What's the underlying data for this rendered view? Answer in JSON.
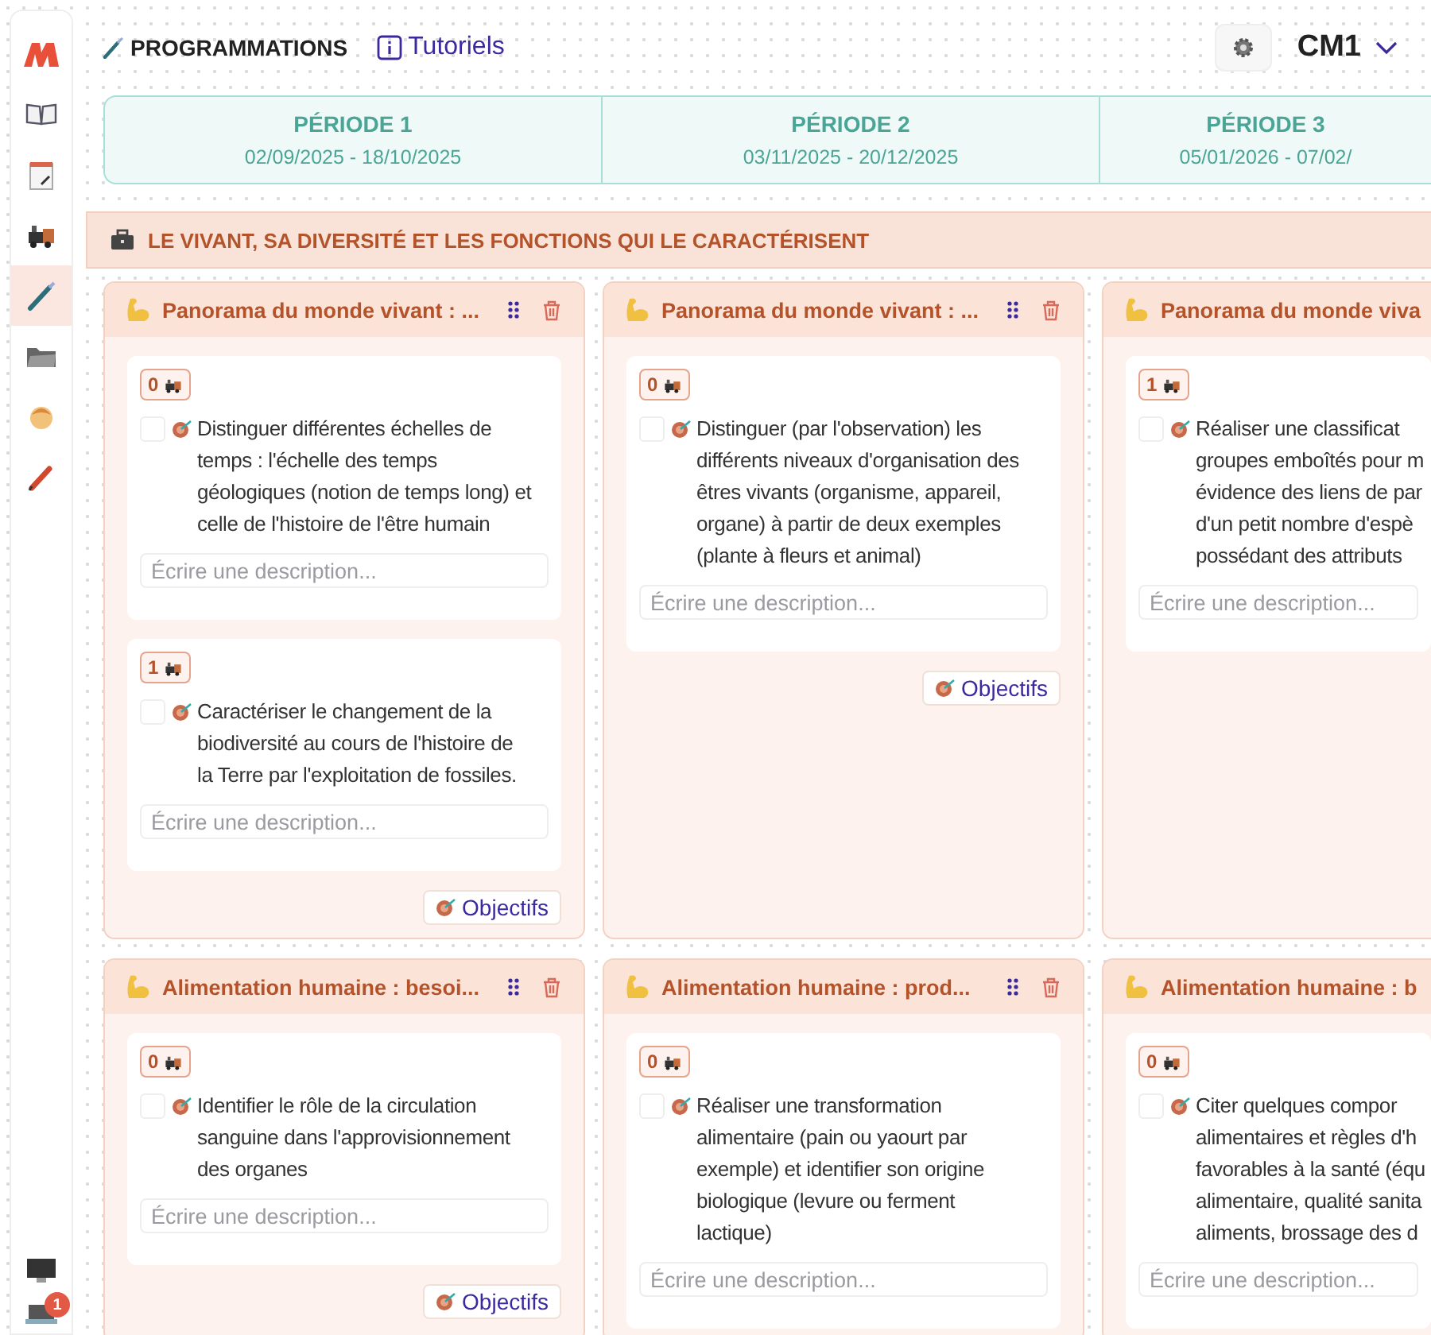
{
  "sidebar": {
    "items": [
      {
        "kind": "logo",
        "selected": false
      },
      {
        "kind": "book",
        "selected": false
      },
      {
        "kind": "notepad",
        "selected": false
      },
      {
        "kind": "train",
        "selected": false
      },
      {
        "kind": "brush",
        "selected": true
      },
      {
        "kind": "folder",
        "selected": false
      },
      {
        "kind": "child",
        "selected": false
      },
      {
        "kind": "pencil",
        "selected": false
      }
    ],
    "bottom_items": [
      {
        "kind": "monitor"
      },
      {
        "kind": "laptop",
        "badge": "1"
      }
    ]
  },
  "header": {
    "title": "PROGRAMMATIONS",
    "link": "Tutoriels",
    "class_selector": "CM1"
  },
  "periods": [
    {
      "label": "PÉRIODE 1",
      "dates": "02/09/2025 - 18/10/2025"
    },
    {
      "label": "PÉRIODE 2",
      "dates": "03/11/2025 - 20/12/2025"
    },
    {
      "label": "PÉRIODE 3",
      "dates": "05/01/2026 - 07/02/"
    }
  ],
  "category": {
    "title": "LE VIVANT, SA DIVERSITÉ ET LES FONCTIONS QUI LE CARACTÉRISENT"
  },
  "cards": [
    {
      "title": "Panorama du monde vivant : ...",
      "tools": true,
      "button": "Objectifs",
      "objectives": [
        {
          "count": "0",
          "checked": false,
          "lines": [
            "Distinguer différentes échelles de",
            "temps : l'échelle des temps",
            "géologiques (notion de temps long) et",
            "celle de l'histoire de l'être humain"
          ],
          "placeholder": "Écrire une description..."
        },
        {
          "count": "1",
          "checked": false,
          "lines": [
            "Caractériser le changement de la",
            "biodiversité au cours de l'histoire de",
            "la Terre par l'exploitation de fossiles."
          ],
          "placeholder": "Écrire une description..."
        }
      ]
    },
    {
      "title": "Panorama du monde vivant : ...",
      "tools": true,
      "button": "Objectifs",
      "objectives": [
        {
          "count": "0",
          "checked": false,
          "lines": [
            "Distinguer (par l'observation) les",
            "différents niveaux d'organisation des",
            "êtres vivants (organisme, appareil,",
            "organe) à partir de deux exemples",
            "(plante à fleurs et animal)"
          ],
          "placeholder": "Écrire une description..."
        }
      ]
    },
    {
      "title": "Panorama du monde viva",
      "tools": false,
      "objectives": [
        {
          "count": "1",
          "checked": false,
          "lines": [
            "Réaliser une classificat",
            "groupes emboîtés pour m",
            "évidence des liens de par",
            "d'un petit nombre d'espè",
            "possédant des attributs"
          ],
          "placeholder": "Écrire une description..."
        }
      ]
    },
    {
      "title": "Alimentation humaine : besoi...",
      "tools": true,
      "button": "Objectifs",
      "objectives": [
        {
          "count": "0",
          "checked": false,
          "lines": [
            "Identifier le rôle de la circulation",
            "sanguine dans l'approvisionnement",
            "des organes"
          ],
          "placeholder": "Écrire une description..."
        }
      ]
    },
    {
      "title": "Alimentation humaine : prod...",
      "tools": true,
      "objectives": [
        {
          "count": "0",
          "checked": false,
          "lines": [
            "Réaliser une transformation",
            "alimentaire (pain ou yaourt par",
            "exemple) et identifier son origine",
            "biologique (levure ou ferment",
            "lactique)"
          ],
          "placeholder": "Écrire une description..."
        }
      ]
    },
    {
      "title": "Alimentation humaine : b",
      "tools": false,
      "objectives": [
        {
          "count": "0",
          "checked": false,
          "lines": [
            "Citer quelques compor",
            "alimentaires et règles d'h",
            "favorables à la santé (équ",
            "alimentaire, qualité sanita",
            "aliments, brossage des d"
          ],
          "placeholder": "Écrire une description..."
        }
      ]
    }
  ]
}
